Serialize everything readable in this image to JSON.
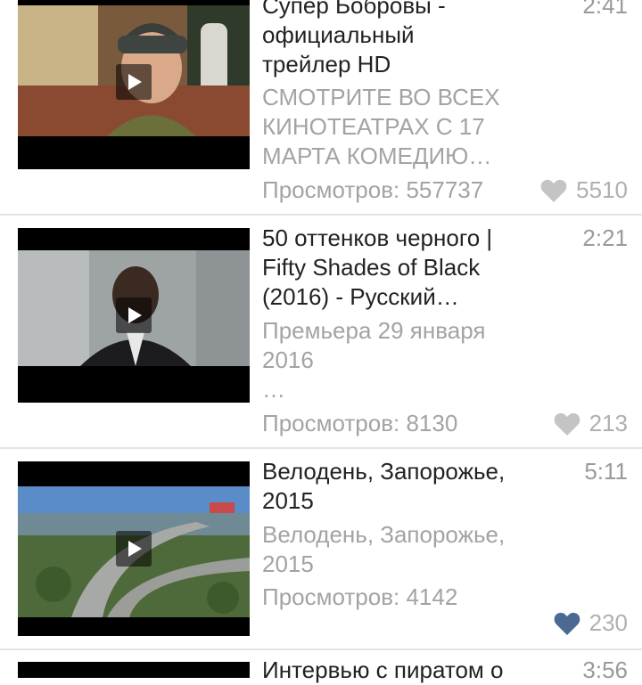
{
  "videos": [
    {
      "title": "Супер Бобровы -\nофициальный\nтрейлер HD",
      "duration": "2:41",
      "description": "СМОТРИТЕ ВО ВСЕХ\nКИНОТЕАТРАХ С 17\nМАРТА КОМЕДИЮ…",
      "views": "Просмотров: 557737",
      "likes": "5510",
      "liked": false
    },
    {
      "title": "50 оттенков черного |\nFifty Shades of Black\n(2016) - Русский…",
      "duration": "2:21",
      "description": "Премьера 29 января\n2016\n…",
      "views": "Просмотров: 8130",
      "likes": "213",
      "liked": false
    },
    {
      "title": "Велодень, Запорожье,\n2015",
      "duration": "5:11",
      "description": "Велодень, Запорожье,\n2015",
      "views": "Просмотров: 4142",
      "likes": "230",
      "liked": true
    },
    {
      "title": "Интервью с пиратом о",
      "duration": "3:56"
    }
  ],
  "colors": {
    "liked_heart": "#4a6a93",
    "unliked_heart": "#c4c4c4",
    "divider": "#e4e4e4",
    "title_text": "#222222",
    "secondary_text": "#a3a3a3"
  },
  "icons": {
    "play": "play-icon",
    "like": "heart-icon"
  }
}
